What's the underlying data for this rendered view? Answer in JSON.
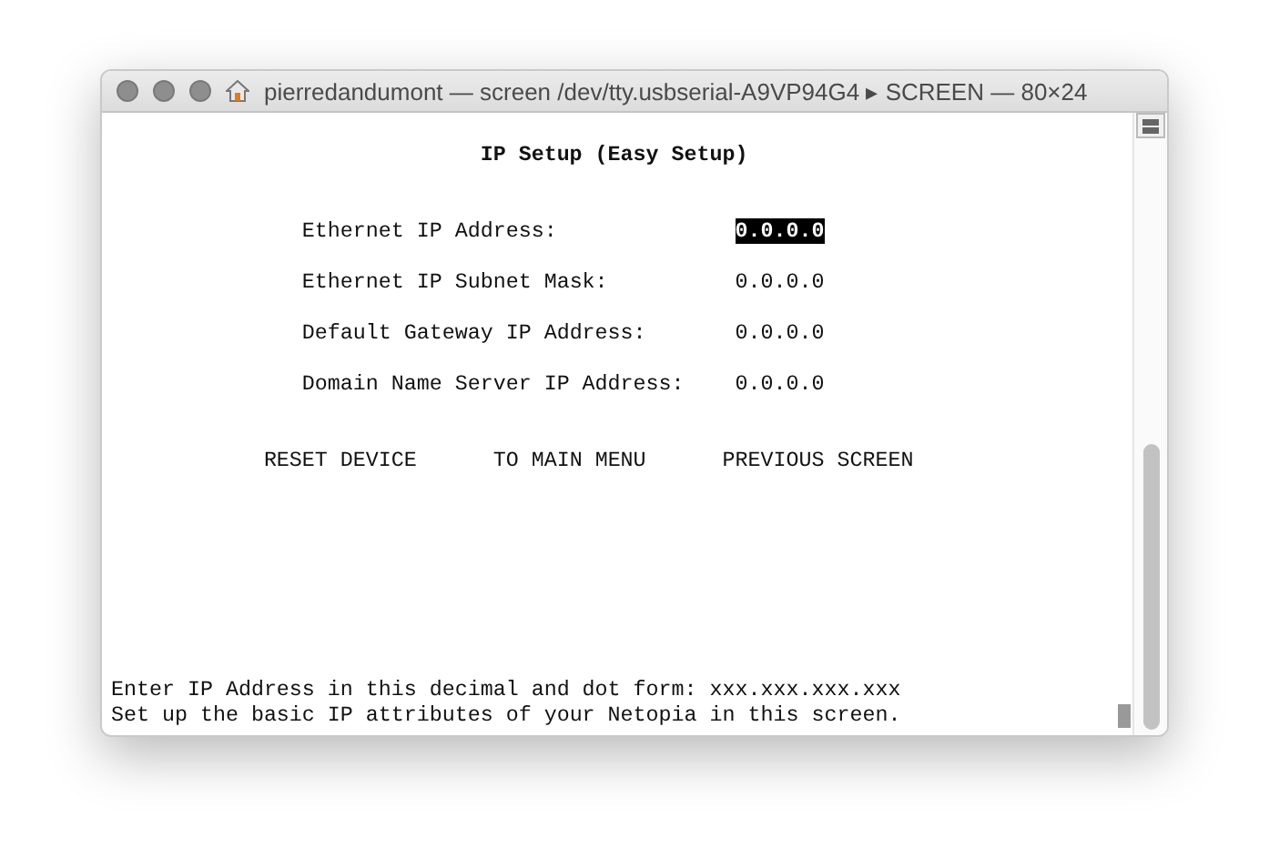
{
  "window": {
    "title": "pierredandumont — screen /dev/tty.usbserial-A9VP94G4 ▸ SCREEN — 80×24"
  },
  "screen": {
    "heading": "IP Setup (Easy Setup)",
    "fields": [
      {
        "label": "Ethernet IP Address:",
        "value": "0.0.0.0",
        "selected": true
      },
      {
        "label": "Ethernet IP Subnet Mask:",
        "value": "0.0.0.0",
        "selected": false
      },
      {
        "label": "Default Gateway IP Address:",
        "value": "0.0.0.0",
        "selected": false
      },
      {
        "label": "Domain Name Server IP Address:",
        "value": "0.0.0.0",
        "selected": false
      }
    ],
    "menu": [
      "RESET DEVICE",
      "TO MAIN MENU",
      "PREVIOUS SCREEN"
    ],
    "help_lines": [
      "Enter IP Address in this decimal and dot form: xxx.xxx.xxx.xxx",
      "Set up the basic IP attributes of your Netopia in this screen."
    ]
  }
}
